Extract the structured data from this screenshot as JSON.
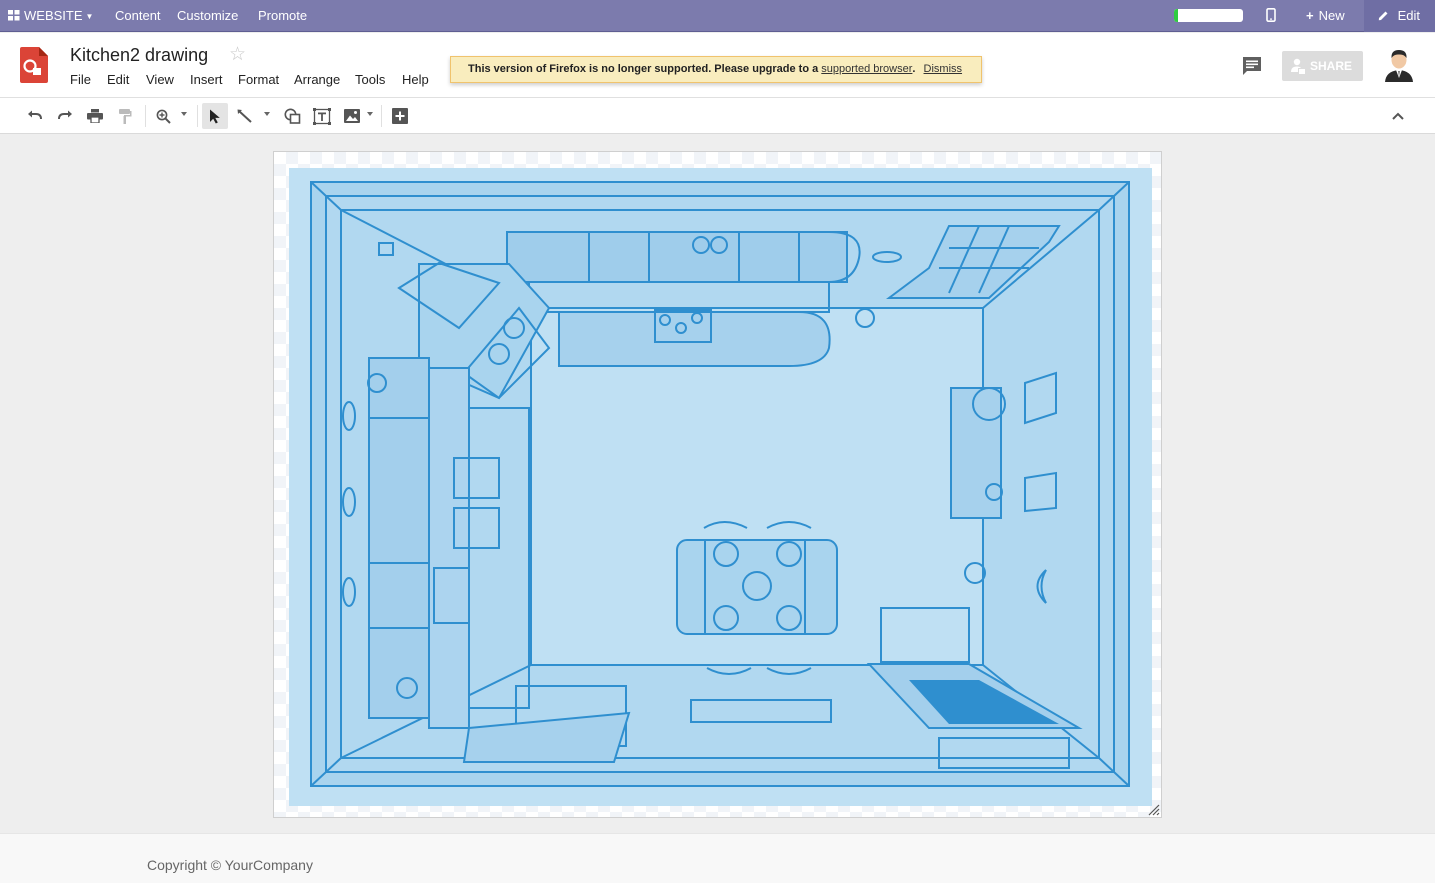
{
  "topbar": {
    "website_label": "WEBSITE",
    "content_label": "Content",
    "customize_label": "Customize",
    "promote_label": "Promote",
    "new_label": "New",
    "edit_label": "Edit",
    "progress_fraction": 0.06,
    "bar_color": "#7c7bad"
  },
  "document": {
    "title": "Kitchen2 drawing",
    "menu": [
      "File",
      "Edit",
      "View",
      "Insert",
      "Format",
      "Arrange",
      "Tools",
      "Help"
    ],
    "logo_color": "#db4437"
  },
  "notice": {
    "text": "This version of Firefox is no longer supported. Please upgrade to a",
    "link_text": "supported browser",
    "period": ".",
    "dismiss_label": "Dismiss"
  },
  "header_right": {
    "share_label": "SHARE"
  },
  "toolbar": {
    "icons": [
      "undo-icon",
      "redo-icon",
      "print-icon",
      "paint-format-icon",
      "zoom-icon",
      "select-icon",
      "line-icon",
      "shape-icon",
      "textbox-icon",
      "image-icon",
      "add-comment-icon",
      "collapse-icon"
    ],
    "active_tool": "select-icon"
  },
  "canvas": {
    "image_description_name": "kitchen-blueprint-image",
    "blueprint_color": "#2f8fcf"
  },
  "footer": {
    "copyright": "Copyright © YourCompany"
  }
}
